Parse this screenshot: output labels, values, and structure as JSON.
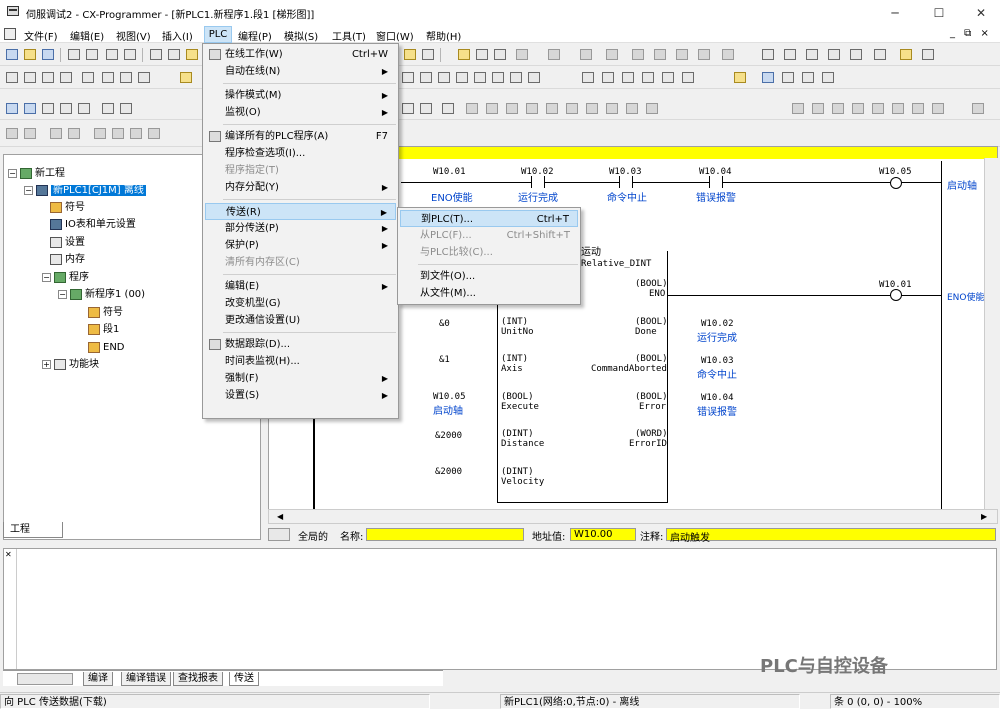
{
  "window": {
    "title": "伺服调试2 - CX-Programmer - [新PLC1.新程序1.段1 [梯形图]]",
    "minimize": "─",
    "maximize": "☐",
    "close": "✕"
  },
  "menubar": {
    "items": [
      "文件(F)",
      "编辑(E)",
      "视图(V)",
      "插入(I)",
      "PLC",
      "编程(P)",
      "模拟(S)",
      "工具(T)",
      "窗口(W)",
      "帮助(H)"
    ],
    "active": "PLC",
    "right_controls": "_ ⧉ ×"
  },
  "tree": {
    "root": "新工程",
    "plc": "新PLC1[CJ1M] 离线",
    "items": [
      "符号",
      "IO表和单元设置",
      "设置",
      "内存",
      "程序",
      "新程序1 (00)",
      "符号",
      "段1",
      "END",
      "功能块"
    ],
    "tab": "工程"
  },
  "ladder": {
    "contacts": [
      {
        "addr": "W10.01",
        "comment": "ENO使能"
      },
      {
        "addr": "W10.02",
        "comment": "运行完成"
      },
      {
        "addr": "W10.03",
        "comment": "命令中止"
      },
      {
        "addr": "W10.04",
        "comment": "错误报警"
      }
    ],
    "coil1": {
      "addr": "W10.05",
      "comment": "启动轴"
    },
    "coil2": {
      "addr": "W10.01",
      "comment": "ENO使能"
    },
    "fb_title_tail": "运动",
    "fb_name": "Relative_DINT",
    "fb_params": [
      {
        "in_val": "",
        "in_type": "",
        "in_name": "",
        "out_type": "(BOOL)",
        "out_name": "ENO",
        "out_addr": "",
        "out_cmt": ""
      },
      {
        "in_val": "&0",
        "in_type": "(INT)",
        "in_name": "UnitNo",
        "out_type": "(BOOL)",
        "out_name": "Done",
        "out_addr": "W10.02",
        "out_cmt": "运行完成"
      },
      {
        "in_val": "&1",
        "in_type": "(INT)",
        "in_name": "Axis",
        "out_type": "(BOOL)",
        "out_name": "CommandAborted",
        "out_addr": "W10.03",
        "out_cmt": "命令中止"
      },
      {
        "in_val": "W10.05",
        "in_cmt": "启动轴",
        "in_type": "(BOOL)",
        "in_name": "Execute",
        "out_type": "(BOOL)",
        "out_name": "Error",
        "out_addr": "W10.04",
        "out_cmt": "错误报警"
      },
      {
        "in_val": "&2000",
        "in_type": "(DINT)",
        "in_name": "Distance",
        "out_type": "(WORD)",
        "out_name": "ErrorID",
        "out_addr": "",
        "out_cmt": ""
      },
      {
        "in_val": "&2000",
        "in_type": "(DINT)",
        "in_name": "Velocity",
        "out_type": "",
        "out_name": "",
        "out_addr": "",
        "out_cmt": ""
      }
    ]
  },
  "infobar": {
    "scope": "全局的",
    "name_label": "名称:",
    "name_value": "",
    "addr_label": "地址值:",
    "addr_value": "W10.00",
    "comment_label": "注释:",
    "comment_value": "启动触发"
  },
  "output_tabs": [
    "编译",
    "编译错误",
    "查找报表",
    "传送"
  ],
  "status": {
    "left": "向 PLC 传送数据(下载)",
    "mid": "新PLC1(网络:0,节点:0) - 离线",
    "right": "条 0 (0, 0)  - 100%"
  },
  "plc_menu": {
    "items": [
      {
        "label": "在线工作(W)",
        "shortcut": "Ctrl+W",
        "dis": false,
        "arrow": false,
        "icon": "warning-icon"
      },
      {
        "label": "自动在线(N)",
        "shortcut": "",
        "dis": false,
        "arrow": true
      },
      {
        "sep": true
      },
      {
        "label": "操作模式(M)",
        "shortcut": "",
        "dis": false,
        "arrow": true
      },
      {
        "label": "监视(O)",
        "shortcut": "",
        "dis": false,
        "arrow": true
      },
      {
        "sep": true
      },
      {
        "label": "编译所有的PLC程序(A)",
        "shortcut": "F7",
        "dis": false,
        "arrow": false,
        "icon": "compile-icon"
      },
      {
        "label": "程序检查选项(I)...",
        "shortcut": "",
        "dis": false,
        "arrow": false
      },
      {
        "label": "程序指定(T)",
        "shortcut": "",
        "dis": true,
        "arrow": false
      },
      {
        "label": "内存分配(Y)",
        "shortcut": "",
        "dis": false,
        "arrow": true
      },
      {
        "sep": true
      },
      {
        "label": "传送(R)",
        "shortcut": "",
        "dis": false,
        "arrow": true,
        "hl": true
      },
      {
        "label": "部分传送(P)",
        "shortcut": "",
        "dis": false,
        "arrow": true
      },
      {
        "label": "保护(P)",
        "shortcut": "",
        "dis": false,
        "arrow": true
      },
      {
        "label": "清所有内存区(C)",
        "shortcut": "",
        "dis": true,
        "arrow": false
      },
      {
        "sep": true
      },
      {
        "label": "编辑(E)",
        "shortcut": "",
        "dis": false,
        "arrow": true
      },
      {
        "label": "改变机型(G)",
        "shortcut": "",
        "dis": false,
        "arrow": false
      },
      {
        "label": "更改通信设置(U)",
        "shortcut": "",
        "dis": false,
        "arrow": false
      },
      {
        "sep": true
      },
      {
        "label": "数据跟踪(D)...",
        "shortcut": "",
        "dis": false,
        "arrow": false,
        "icon": "trace-icon"
      },
      {
        "label": "时间表监视(H)...",
        "shortcut": "",
        "dis": false,
        "arrow": false
      },
      {
        "label": "强制(F)",
        "shortcut": "",
        "dis": false,
        "arrow": true
      },
      {
        "label": "设置(S)",
        "shortcut": "",
        "dis": false,
        "arrow": true
      }
    ]
  },
  "transfer_menu": {
    "items": [
      {
        "label": "到PLC(T)...",
        "shortcut": "Ctrl+T",
        "dis": false,
        "hl": true
      },
      {
        "label": "从PLC(F)...",
        "shortcut": "Ctrl+Shift+T",
        "dis": true
      },
      {
        "label": "与PLC比较(C)...",
        "shortcut": "",
        "dis": true
      },
      {
        "sep": true
      },
      {
        "label": "到文件(O)...",
        "shortcut": "",
        "dis": false
      },
      {
        "label": "从文件(M)...",
        "shortcut": "",
        "dis": false
      }
    ]
  },
  "watermark": "PLC与自控设备"
}
